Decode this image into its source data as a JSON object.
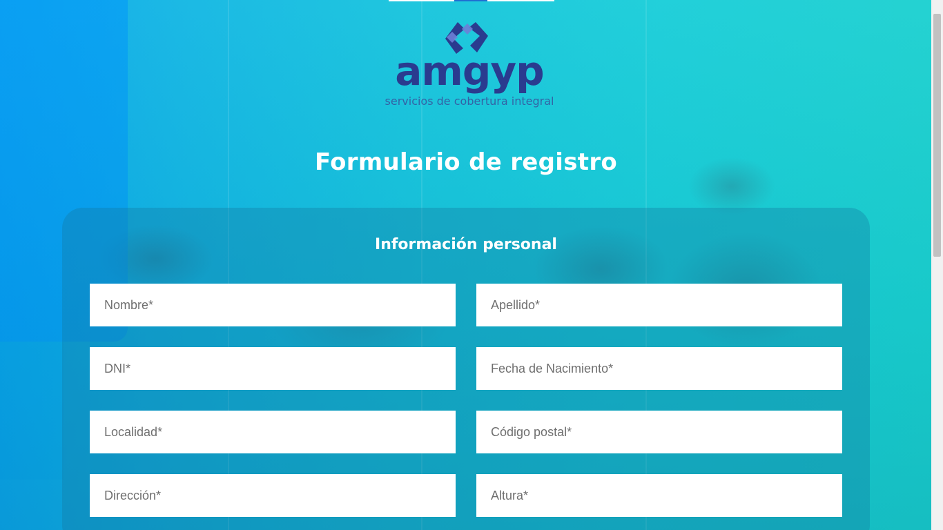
{
  "logo": {
    "wordmark": "amgyp",
    "tagline": "servicios de cobertura integral",
    "colors": {
      "dark": "#2a3b8f",
      "light": "#6d7fd6"
    }
  },
  "page": {
    "title": "Formulario de registro"
  },
  "section": {
    "title": "Información personal"
  },
  "fields": {
    "nombre": {
      "placeholder": "Nombre*"
    },
    "apellido": {
      "placeholder": "Apellido*"
    },
    "dni": {
      "placeholder": "DNI*"
    },
    "fecha_nacimiento": {
      "placeholder": "Fecha de Nacimiento*"
    },
    "localidad": {
      "placeholder": "Localidad*"
    },
    "codigo_postal": {
      "placeholder": "Código postal*"
    },
    "direccion": {
      "placeholder": "Dirección*"
    },
    "altura": {
      "placeholder": "Altura*"
    }
  },
  "colors": {
    "accent": "#14c4dc",
    "title_text": "#ffffff",
    "field_bg": "#ffffff"
  }
}
